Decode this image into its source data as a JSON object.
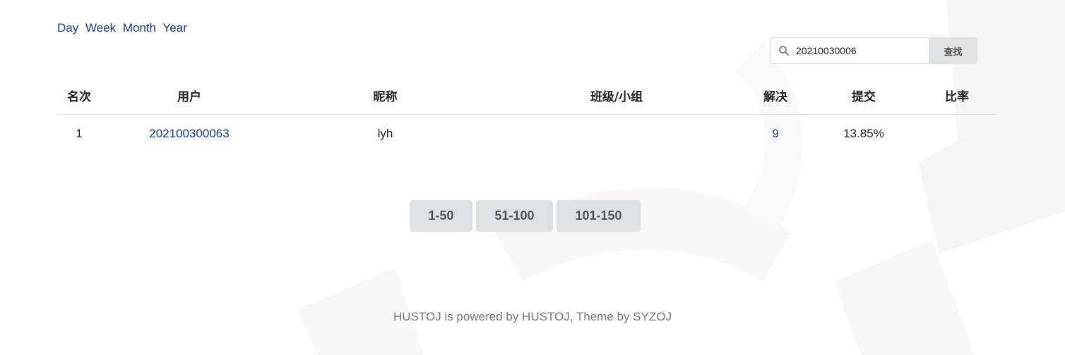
{
  "period_links": [
    "Day",
    "Week",
    "Month",
    "Year"
  ],
  "search": {
    "value": "20210030006",
    "button_label": "查找"
  },
  "table": {
    "headers": [
      "名次",
      "用户",
      "昵称",
      "班级/小组",
      "解决",
      "提交",
      "比率"
    ],
    "rows": [
      {
        "rank": "1",
        "user": "202100300063",
        "nickname": "lyh",
        "class_group": "",
        "solved": "9",
        "submitted": "13.85%",
        "ratio": ""
      }
    ]
  },
  "pagination": [
    "1-50",
    "51-100",
    "101-150"
  ],
  "footer": "HUSTOJ is powered by HUSTOJ, Theme by SYZOJ",
  "colors": {
    "link": "#1a3a8c",
    "button_bg": "#e0e1e2",
    "footer_text": "#777777"
  }
}
